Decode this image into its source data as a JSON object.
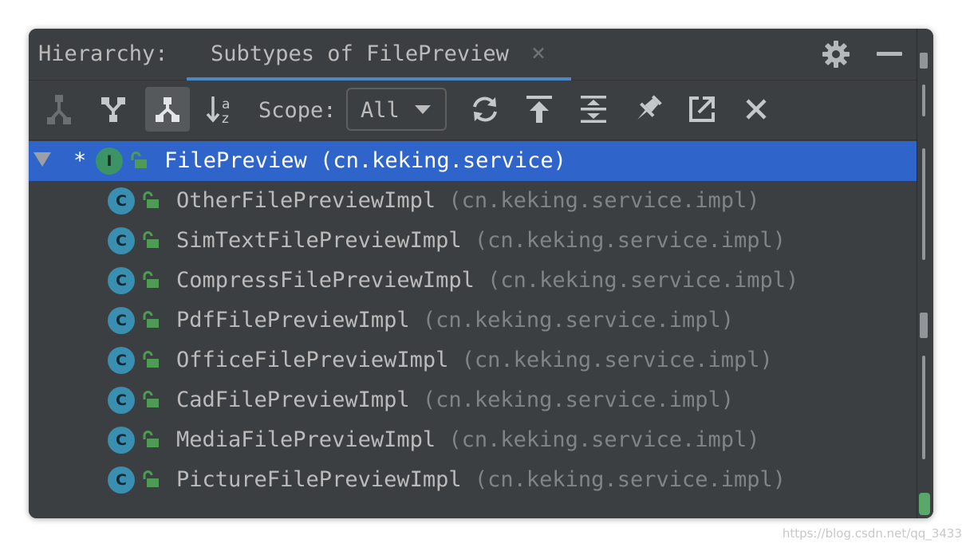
{
  "header": {
    "label": "Hierarchy:",
    "tab_label": "Subtypes of FilePreview",
    "close_glyph": "×"
  },
  "toolbar": {
    "buttons": [
      {
        "icon": "supertypes-hierarchy-icon",
        "state": "disabled"
      },
      {
        "icon": "subtypes-hierarchy-icon",
        "state": "normal"
      },
      {
        "icon": "class-hierarchy-icon",
        "state": "active"
      },
      {
        "icon": "sort-alphabetically-icon",
        "state": "normal"
      },
      {
        "icon": "refresh-icon",
        "state": "normal"
      },
      {
        "icon": "export-icon",
        "state": "normal"
      },
      {
        "icon": "expand-all-icon",
        "state": "normal"
      },
      {
        "icon": "pin-icon",
        "state": "normal"
      },
      {
        "icon": "open-in-new-window-icon",
        "state": "normal"
      },
      {
        "icon": "close-icon",
        "state": "normal"
      }
    ],
    "scope_label": "Scope:",
    "scope_value": "All"
  },
  "tree": {
    "root": {
      "marker": "*",
      "badge": "I",
      "name": "FilePreview",
      "package": " (cn.keking.service)"
    },
    "children": [
      {
        "badge": "C",
        "name": "OtherFilePreviewImpl",
        "package": " (cn.keking.service.impl)"
      },
      {
        "badge": "C",
        "name": "SimTextFilePreviewImpl",
        "package": " (cn.keking.service.impl)"
      },
      {
        "badge": "C",
        "name": "CompressFilePreviewImpl",
        "package": " (cn.keking.service.impl)"
      },
      {
        "badge": "C",
        "name": "PdfFilePreviewImpl",
        "package": " (cn.keking.service.impl)"
      },
      {
        "badge": "C",
        "name": "OfficeFilePreviewImpl",
        "package": " (cn.keking.service.impl)"
      },
      {
        "badge": "C",
        "name": "CadFilePreviewImpl",
        "package": " (cn.keking.service.impl)"
      },
      {
        "badge": "C",
        "name": "MediaFilePreviewImpl",
        "package": " (cn.keking.service.impl)"
      },
      {
        "badge": "C",
        "name": "PictureFilePreviewImpl",
        "package": " (cn.keking.service.impl)"
      }
    ]
  },
  "watermark": "https://blog.csdn.net/qq_3433",
  "colors": {
    "panel": "#3c3f41",
    "selection": "#2f65ca",
    "tab_underline": "#4a88c7",
    "interface_badge": "#3c9466",
    "class_badge": "#3a8fb0",
    "lock_green": "#4f9a55"
  }
}
